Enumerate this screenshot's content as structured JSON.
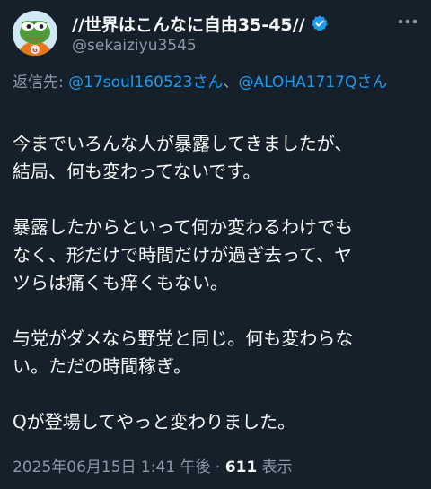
{
  "author": {
    "display_name": "//世界はこんなに自由35-45//",
    "handle": "@sekaiziyu3545",
    "verified_icon": "verified-badge-icon",
    "avatar_icon": "pepe-frog-avatar"
  },
  "reply_to": {
    "prefix": "返信先: ",
    "mentions": [
      "@17soul160523さん",
      "@ALOHA1717Qさん"
    ],
    "separator": "、"
  },
  "body": {
    "line1": "今までいろんな人が暴露してきましたが、",
    "line2": "結局、何も変わってないです。",
    "line3": "暴露したからといって何か変わるわけでも",
    "line4": "なく、形だけで時間だけが過ぎ去って、ヤ",
    "line5": "ツらは痛くも痒くもない。",
    "line6": "与党がダメなら野党と同じ。何も変わらな",
    "line7": "い。ただの時間稼ぎ。",
    "line8": "Qが登場してやっと変わりました。"
  },
  "meta": {
    "timestamp": "2025年06月15日 1:41 午後",
    "separator": " · ",
    "views_count": "611",
    "views_label": " 表示"
  },
  "colors": {
    "background": "#15202b",
    "text": "#f7f9f9",
    "secondary": "#8b98a5",
    "link": "#1d9bf0"
  }
}
